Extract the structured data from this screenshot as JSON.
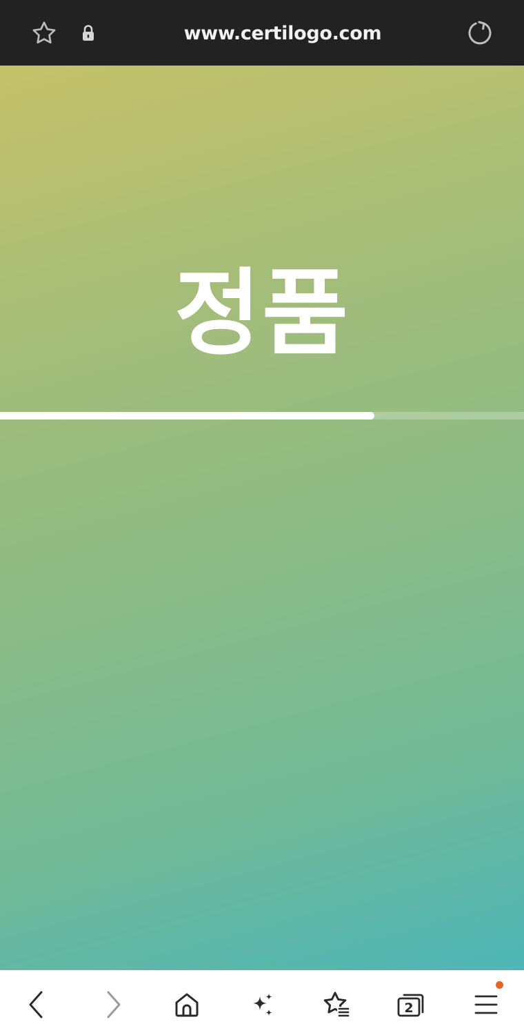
{
  "browser": {
    "url": "www.certilogo.com",
    "icons": {
      "favorite": "star-outline-icon",
      "lock": "lock-icon",
      "reload": "reload-icon"
    }
  },
  "page": {
    "title": "정품",
    "progress": 0.715,
    "gradient_colors": [
      "#c6c269",
      "#a7bd78",
      "#8fbb84",
      "#72b998",
      "#4db6b6"
    ]
  },
  "bottom_nav": {
    "items": [
      {
        "icon": "back-arrow-icon"
      },
      {
        "icon": "forward-arrow-icon"
      },
      {
        "icon": "home-icon"
      },
      {
        "icon": "sparkle-icon"
      },
      {
        "icon": "bookmarks-icon"
      },
      {
        "icon": "tabs-icon",
        "count": "2"
      },
      {
        "icon": "menu-icon",
        "has_notification": true
      }
    ],
    "notification_color": "#e8632a"
  }
}
